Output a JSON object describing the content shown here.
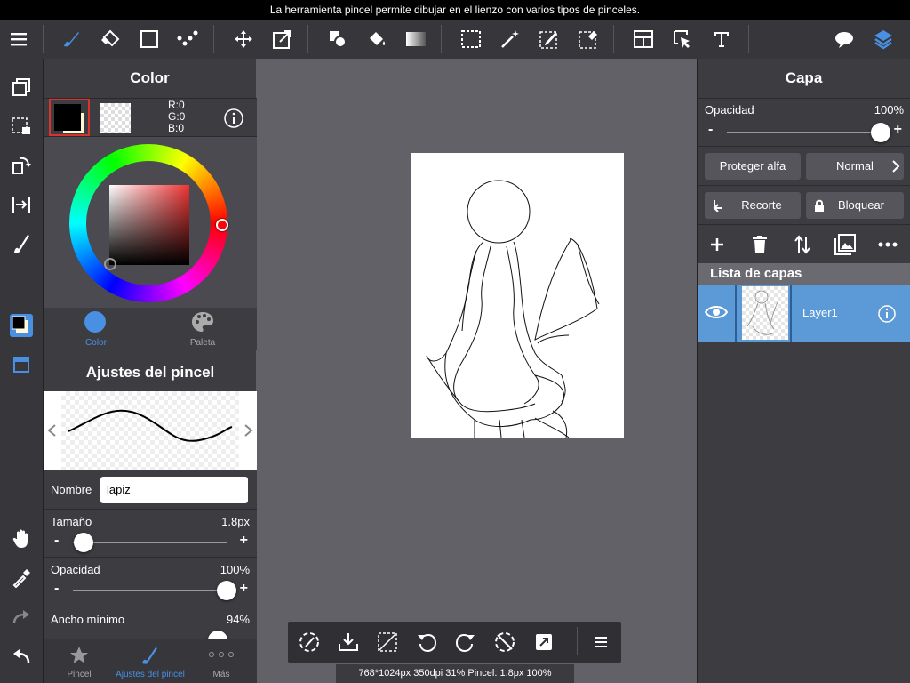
{
  "hint": "La herramienta pincel permite dibujar en el lienzo con varios tipos de pinceles.",
  "colors": {
    "accent": "#4a90e2",
    "selected_layer": "#5b9ad7",
    "panel": "#3c3c41",
    "toolbar": "#36363b",
    "canvas_bg": "#616167"
  },
  "toolbar": {
    "tools": [
      "menu-icon",
      "brush-icon",
      "eraser-icon",
      "rectangle-icon",
      "dots-icon",
      "move-icon",
      "transform-icon",
      "shape-fill-icon",
      "bucket-icon",
      "gradient-icon",
      "select-rect-icon",
      "magic-wand-icon",
      "select-pen-icon",
      "select-eraser-icon",
      "frame-icon",
      "pointer-icon",
      "text-icon",
      "speech-icon",
      "layers-icon"
    ]
  },
  "left_panel": {
    "color_title": "Color",
    "rgb": {
      "r": "R:0",
      "g": "G:0",
      "b": "B:0"
    },
    "tabs": {
      "color": "Color",
      "palette": "Paleta"
    },
    "brush_title": "Ajustes del pincel",
    "name_label": "Nombre",
    "name_value": "lapiz",
    "size": {
      "label": "Tamaño",
      "value": "1.8px",
      "level": 0.07
    },
    "opacity": {
      "label": "Opacidad",
      "value": "100%",
      "level": 1.0
    },
    "min_width": {
      "label": "Ancho mínimo",
      "value": "94%",
      "level": 0.94
    },
    "bottom_tabs": {
      "pincel": "Pincel",
      "ajustes": "Ajustes del pincel",
      "mas": "Más"
    }
  },
  "right_panel": {
    "title": "Capa",
    "opacity_label": "Opacidad",
    "opacity_value": "100%",
    "opacity_level": 1.0,
    "protect_alpha": "Proteger alfa",
    "blend_mode": "Normal",
    "clipping": "Recorte",
    "lock": "Bloquear",
    "list_header": "Lista de capas",
    "layers": [
      {
        "name": "Layer1"
      }
    ]
  },
  "status": "768*1024px 350dpi 31% Pincel: 1.8px 100%"
}
